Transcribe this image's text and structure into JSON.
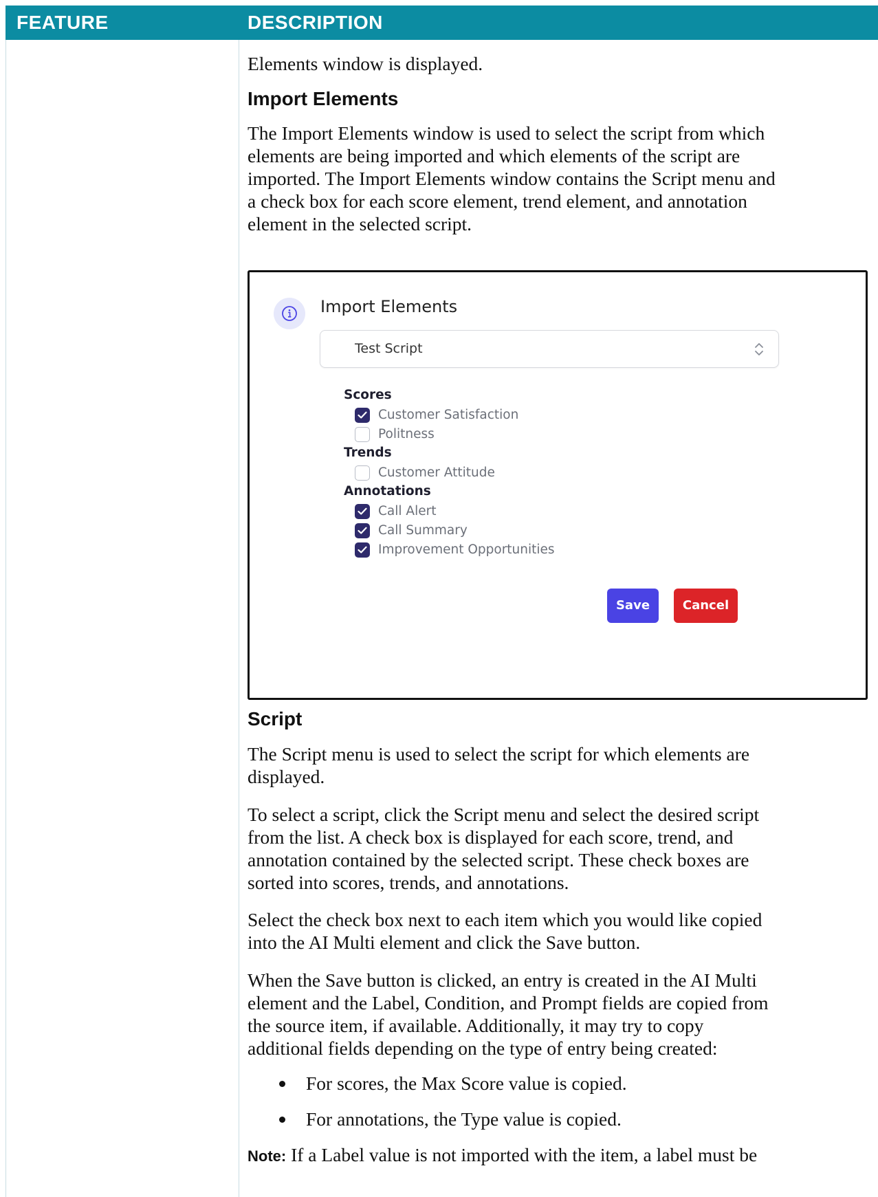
{
  "table": {
    "header": {
      "feature": "FEATURE",
      "description": "DESCRIPTION"
    }
  },
  "description": {
    "intro_line": "Elements window is displayed.",
    "import_heading": "Import Elements",
    "import_paragraph_lines": [
      "The Import Elements window is used to select the script from which",
      "elements are being imported and which elements of the script are",
      "imported. The Import Elements window contains the Script menu and",
      "a check box for each score element, trend element, and annotation",
      "element in the selected script."
    ],
    "script_heading": "Script",
    "script_para1_lines": [
      "The Script menu is used to select the script for which elements are",
      "displayed."
    ],
    "script_para2_lines": [
      "To select a script, click the Script menu and select the desired script",
      "from the list. A check box is displayed for each score, trend, and",
      "annotation contained by the selected script. These check boxes are",
      "sorted into scores, trends, and annotations."
    ],
    "script_para3_lines": [
      "Select the check box next to each item which you would like copied",
      "into the AI Multi element and click the Save button."
    ],
    "script_para4_lines": [
      "When the Save button is clicked, an entry is created in the AI Multi",
      "element and the Label, Condition, and Prompt fields are copied from",
      "the source item, if available. Additionally, it may try to copy",
      "additional fields depending on the type of entry being created:"
    ],
    "bullets": [
      "For scores, the Max Score value is copied.",
      "For annotations, the Type value is copied."
    ],
    "note_label": "Note:",
    "note_text": " If a Label value is not imported with the item, a label must be"
  },
  "dialog": {
    "title": "Import Elements",
    "info_icon": "info-icon",
    "script_select_value": "Test Script",
    "groups": [
      {
        "label": "Scores",
        "items": [
          {
            "label": "Customer Satisfaction",
            "checked": true
          },
          {
            "label": "Politness",
            "checked": false
          }
        ]
      },
      {
        "label": "Trends",
        "items": [
          {
            "label": "Customer Attitude",
            "checked": false
          }
        ]
      },
      {
        "label": "Annotations",
        "items": [
          {
            "label": "Call Alert",
            "checked": true
          },
          {
            "label": "Call Summary",
            "checked": true
          },
          {
            "label": "Improvement Opportunities",
            "checked": true
          }
        ]
      }
    ],
    "save_label": "Save",
    "cancel_label": "Cancel",
    "colors": {
      "checkbox_checked": "#2e2a6b",
      "save_button": "#4a43e4",
      "cancel_button": "#dc2428",
      "header_band": "#0c8ca2"
    }
  }
}
